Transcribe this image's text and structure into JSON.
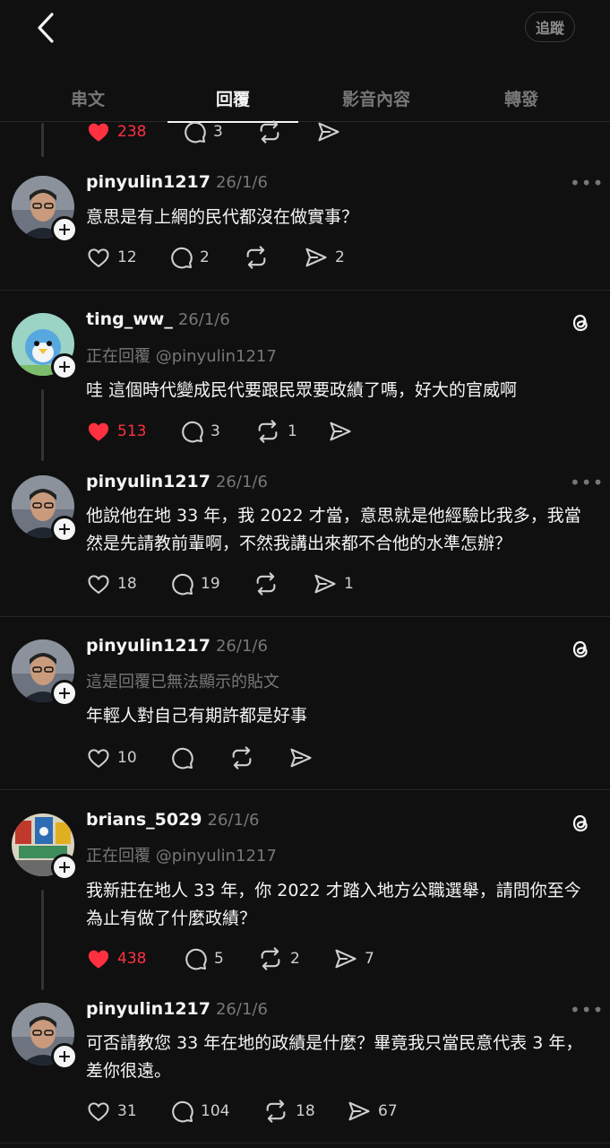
{
  "header": {
    "follow_label": "追蹤"
  },
  "tabs": [
    {
      "label": "串文"
    },
    {
      "label": "回覆"
    },
    {
      "label": "影音內容"
    },
    {
      "label": "轉發"
    }
  ],
  "colors": {
    "background": "#101010",
    "like_active": "#ff3040",
    "muted": "#777777",
    "text": "#f3f5f7"
  },
  "top_actions": {
    "likes": "238",
    "replies": "3"
  },
  "posts": [
    {
      "username": "pinyulin1217",
      "time": "26/1/6",
      "text": "意思是有上網的民代都沒在做實事？",
      "likes": "12",
      "replies": "2",
      "reposts": "",
      "shares": "2",
      "liked": false,
      "menu": "dots"
    },
    {
      "username": "ting_ww_",
      "time": "26/1/6",
      "replying": "正在回覆 @pinyulin1217",
      "text": "哇 這個時代變成民代要跟民眾要政績了嗎，好大的官威啊",
      "likes": "513",
      "replies": "3",
      "reposts": "1",
      "shares": "",
      "liked": true,
      "menu": "threads"
    },
    {
      "username": "pinyulin1217",
      "time": "26/1/6",
      "text": "他說他在地 33 年，我 2022 才當，意思就是他經驗比我多，我當然是先請教前輩啊，不然我講出來都不合他的水準怎辦？",
      "likes": "18",
      "replies": "19",
      "reposts": "",
      "shares": "1",
      "liked": false,
      "menu": "dots"
    },
    {
      "username": "pinyulin1217",
      "time": "26/1/6",
      "replying": "這是回覆已無法顯示的貼文",
      "text": "年輕人對自己有期許都是好事",
      "likes": "10",
      "replies": "",
      "reposts": "",
      "shares": "",
      "liked": false,
      "menu": "threads"
    },
    {
      "username": "brians_5029",
      "time": "26/1/6",
      "replying": "正在回覆 @pinyulin1217",
      "text": "我新莊在地人 33 年，你 2022 才踏入地方公職選舉，請問你至今為止有做了什麼政績？",
      "likes": "438",
      "replies": "5",
      "reposts": "2",
      "shares": "7",
      "liked": true,
      "menu": "threads"
    },
    {
      "username": "pinyulin1217",
      "time": "26/1/6",
      "text": "可否請教您 33 年在地的政績是什麼？畢竟我只當民意代表 3 年，差你很遠。",
      "likes": "31",
      "replies": "104",
      "reposts": "18",
      "shares": "67",
      "liked": false,
      "menu": "dots"
    }
  ]
}
